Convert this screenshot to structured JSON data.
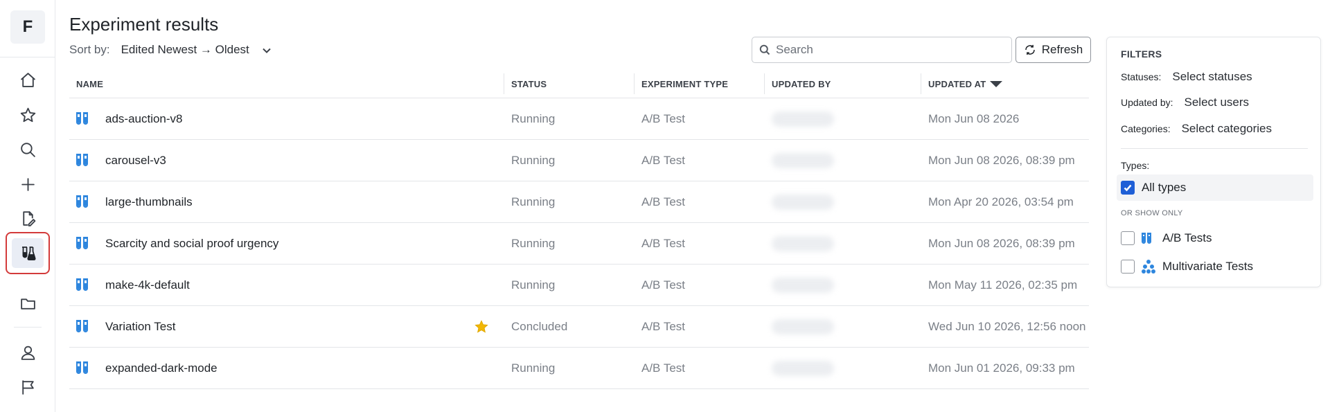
{
  "app": {
    "logo_letter": "F"
  },
  "sidebar": {
    "items": [
      {
        "name": "home",
        "icon": "home-icon"
      },
      {
        "name": "favorites",
        "icon": "star-icon"
      },
      {
        "name": "search",
        "icon": "search-icon"
      },
      {
        "name": "create",
        "icon": "plus-icon"
      },
      {
        "name": "drafts",
        "icon": "edit-document-icon"
      },
      {
        "name": "experiments",
        "icon": "flask-icon",
        "active": true
      },
      {
        "name": "folders",
        "icon": "folder-icon"
      },
      {
        "name": "profile",
        "icon": "user-icon"
      },
      {
        "name": "feedback",
        "icon": "flag-icon"
      }
    ]
  },
  "header": {
    "title": "Experiment results",
    "sort_label": "Sort by:",
    "sort_value": "Edited Newest → Oldest",
    "search_placeholder": "Search",
    "refresh_label": "Refresh"
  },
  "table": {
    "columns": [
      "NAME",
      "STATUS",
      "EXPERIMENT TYPE",
      "UPDATED BY",
      "UPDATED AT"
    ],
    "sorted_column": "UPDATED AT",
    "rows": [
      {
        "name": "ads-auction-v8",
        "starred": false,
        "status": "Running",
        "type": "A/B Test",
        "updated_at": "Mon Jun 08 2026"
      },
      {
        "name": "carousel-v3",
        "starred": false,
        "status": "Running",
        "type": "A/B Test",
        "updated_at": "Mon Jun 08 2026, 08:39 pm"
      },
      {
        "name": "large-thumbnails",
        "starred": false,
        "status": "Running",
        "type": "A/B Test",
        "updated_at": "Mon Apr 20 2026, 03:54 pm"
      },
      {
        "name": "Scarcity and social proof urgency",
        "starred": false,
        "status": "Running",
        "type": "A/B Test",
        "updated_at": "Mon Jun 08 2026, 08:39 pm"
      },
      {
        "name": "make-4k-default",
        "starred": false,
        "status": "Running",
        "type": "A/B Test",
        "updated_at": "Mon May 11 2026, 02:35 pm"
      },
      {
        "name": "Variation Test",
        "starred": true,
        "status": "Concluded",
        "type": "A/B Test",
        "updated_at": "Wed Jun 10 2026, 12:56 noon"
      },
      {
        "name": "expanded-dark-mode",
        "starred": false,
        "status": "Running",
        "type": "A/B Test",
        "updated_at": "Mon Jun 01 2026, 09:33 pm"
      }
    ]
  },
  "filters": {
    "heading": "FILTERS",
    "statuses_label": "Statuses:",
    "statuses_value": "Select statuses",
    "updated_by_label": "Updated by:",
    "updated_by_value": "Select users",
    "categories_label": "Categories:",
    "categories_value": "Select categories",
    "types_label": "Types:",
    "all_types_label": "All types",
    "all_types_checked": true,
    "or_show_only": "OR SHOW ONLY",
    "ab_tests_label": "A/B Tests",
    "multivariate_label": "Multivariate Tests"
  },
  "colors": {
    "accent": "#1f5fd6",
    "ab_icon": "#2e86de",
    "active_outline": "#d33a3a",
    "star": "#f2b705"
  }
}
